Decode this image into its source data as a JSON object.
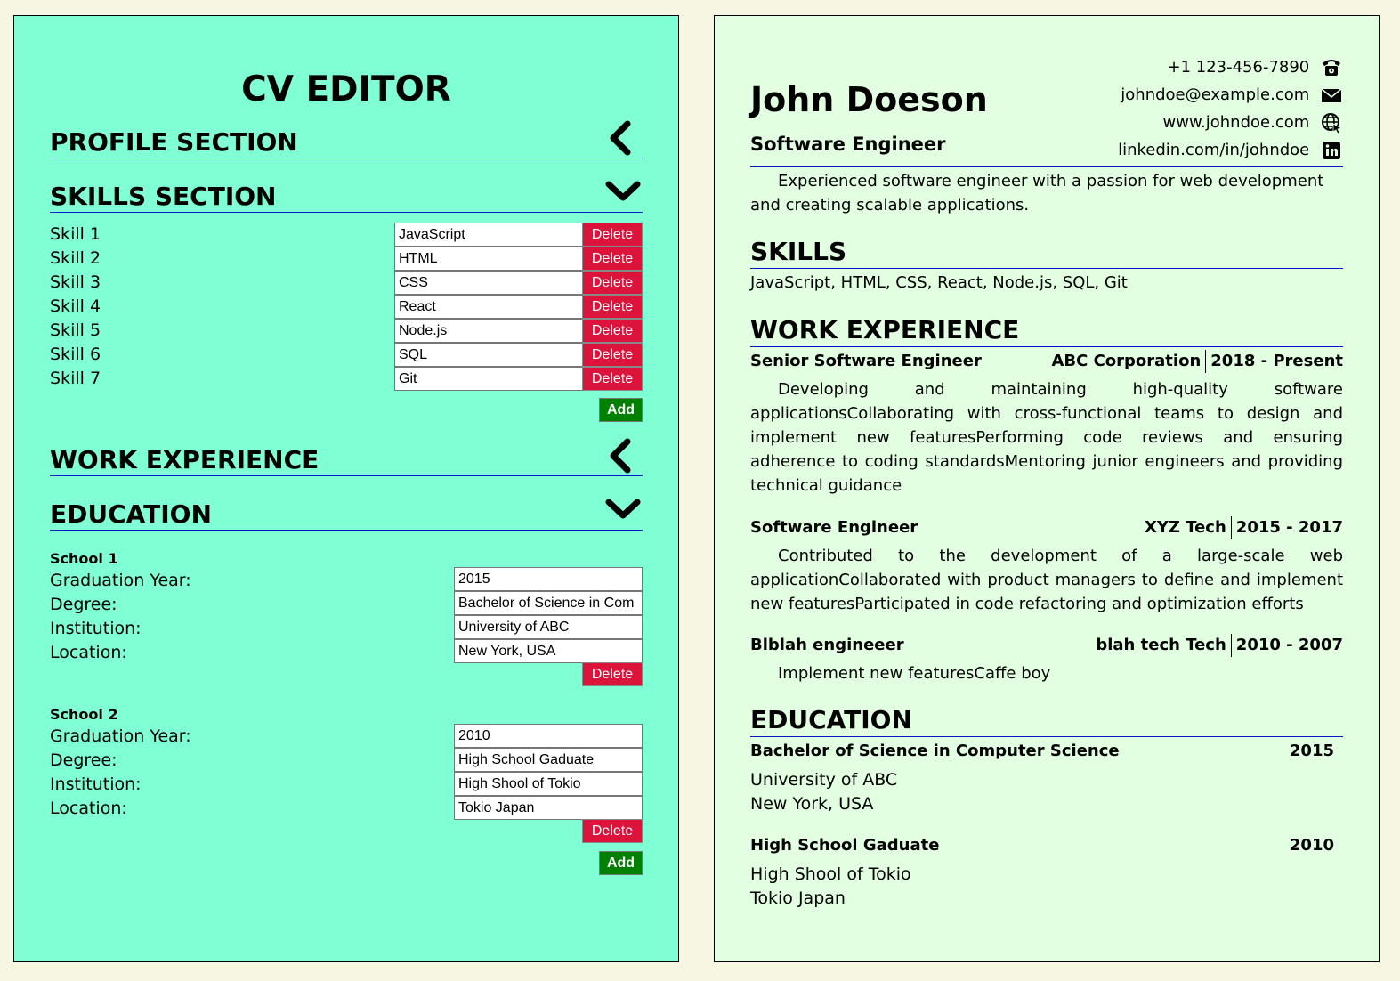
{
  "editor": {
    "title": "CV EDITOR",
    "sections": {
      "profile": "PROFILE SECTION",
      "skills": "SKILLS SECTION",
      "work": "WORK EXPERIENCE",
      "education": "EDUCATION"
    },
    "skills": [
      {
        "label": "Skill 1",
        "value": "JavaScript"
      },
      {
        "label": "Skill 2",
        "value": "HTML"
      },
      {
        "label": "Skill 3",
        "value": "CSS"
      },
      {
        "label": "Skill 4",
        "value": "React"
      },
      {
        "label": "Skill 5",
        "value": "Node.js"
      },
      {
        "label": "Skill 6",
        "value": "SQL"
      },
      {
        "label": "Skill 7",
        "value": "Git"
      }
    ],
    "delete_label": "Delete",
    "add_label": "Add",
    "field_labels": {
      "year": "Graduation Year:",
      "degree": "Degree:",
      "institution": "Institution:",
      "location": "Location:"
    },
    "schools": [
      {
        "heading": "School 1",
        "year": "2015",
        "degree": "Bachelor of Science in Com",
        "institution": "University of ABC",
        "location": "New York, USA"
      },
      {
        "heading": "School 2",
        "year": "2010",
        "degree": "High School Gaduate",
        "institution": "High Shool of Tokio",
        "location": "Tokio Japan"
      }
    ]
  },
  "preview": {
    "name": "John Doeson",
    "title": "Software Engineer",
    "contacts": {
      "phone": "+1 123-456-7890",
      "email": "johndoe@example.com",
      "website": "www.johndoe.com",
      "linkedin": "linkedin.com/in/johndoe"
    },
    "summary": "Experienced software engineer with a passion for web development and creating scalable applications.",
    "skills_heading": "SKILLS",
    "skills_text": "JavaScript, HTML, CSS, React, Node.js, SQL, Git",
    "work_heading": "WORK EXPERIENCE",
    "jobs": [
      {
        "title": "Senior Software Engineer",
        "company": "ABC Corporation",
        "period": "2018 - Present",
        "description": "Developing and maintaining high-quality software applicationsCollaborating with cross-functional teams to design and implement new featuresPerforming code reviews and ensuring adherence to coding standardsMentoring junior engineers and providing technical guidance"
      },
      {
        "title": "Software Engineer",
        "company": "XYZ Tech",
        "period": "2015 - 2017",
        "description": "Contributed to the development of a large-scale web applicationCollaborated with product managers to define and implement new featuresParticipated in code refactoring and optimization efforts"
      },
      {
        "title": "Blblah engineeer",
        "company": "blah tech Tech",
        "period": "2010 - 2007",
        "description": "Implement new featuresCaffe boy"
      }
    ],
    "education_heading": "EDUCATION",
    "education": [
      {
        "degree": "Bachelor of Science in Computer Science",
        "year": "2015",
        "institution": "University of ABC",
        "location": "New York, USA"
      },
      {
        "degree": "High School Gaduate",
        "year": "2010",
        "institution": "High Shool of Tokio",
        "location": "Tokio Japan"
      }
    ]
  },
  "colors": {
    "page_bg": "#f6f6e3",
    "editor_bg": "#80ffd5",
    "preview_bg": "#e2ffe2",
    "delete_btn": "#dc143c",
    "add_btn": "#008000",
    "rule": "#0019c8"
  },
  "icons": {
    "profile_toggle": "chevron-left-icon",
    "skills_toggle": "chevron-down-icon",
    "work_toggle": "chevron-left-icon",
    "education_toggle": "chevron-down-icon",
    "phone": "phone-icon",
    "email": "envelope-icon",
    "website": "globe-icon",
    "linkedin": "linkedin-icon"
  }
}
